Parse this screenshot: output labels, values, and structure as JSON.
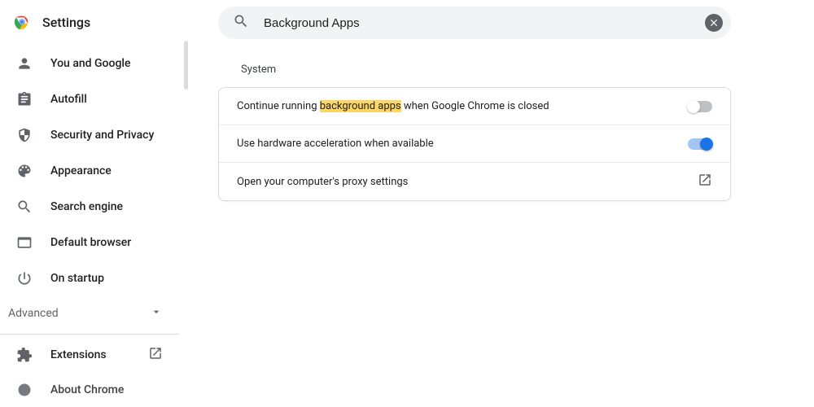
{
  "app_title": "Settings",
  "search": {
    "value": "Background Apps"
  },
  "sidebar": {
    "items": [
      {
        "label": "You and Google"
      },
      {
        "label": "Autofill"
      },
      {
        "label": "Security and Privacy"
      },
      {
        "label": "Appearance"
      },
      {
        "label": "Search engine"
      },
      {
        "label": "Default browser"
      },
      {
        "label": "On startup"
      }
    ],
    "advanced_label": "Advanced",
    "extensions_label": "Extensions",
    "about_label": "About Chrome"
  },
  "section": {
    "title": "System",
    "rows": {
      "bg_pre": "Continue running ",
      "bg_highlight": "background apps",
      "bg_post": " when Google Chrome is closed",
      "hw": "Use hardware acceleration when available",
      "proxy": "Open your computer's proxy settings"
    }
  }
}
